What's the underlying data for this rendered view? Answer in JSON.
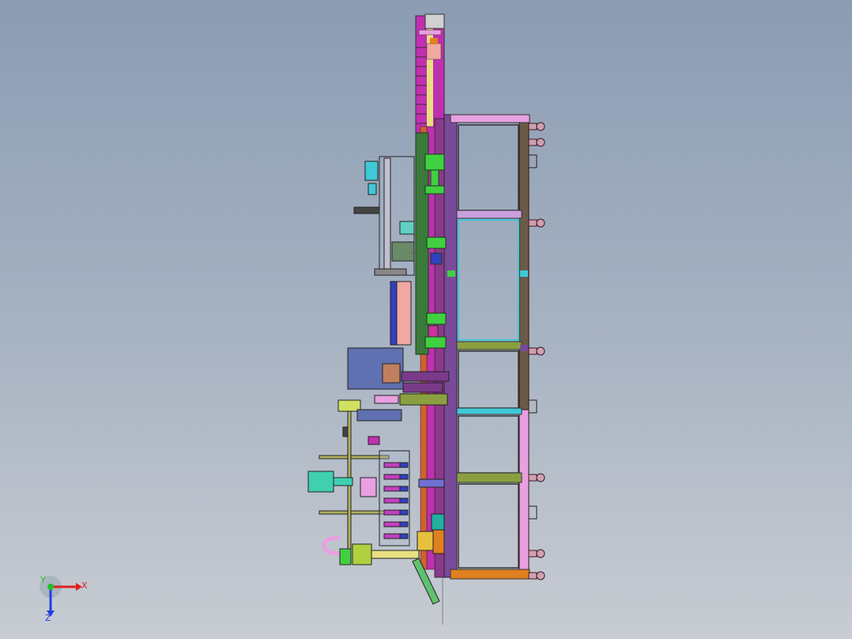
{
  "viewport": {
    "background_top": "#8b9cb3",
    "background_bottom": "#c8ccd3"
  },
  "model": {
    "palette": {
      "frame_brown": "#6b5a48",
      "frame_purple": "#7a4a9a",
      "frame_pink": "#e8a0e0",
      "frame_cyan": "#40c8d8",
      "frame_olive": "#8aa040",
      "rail_green": "#3a7a3a",
      "bright_green": "#40d040",
      "magenta": "#c030b0",
      "yellow": "#e8e080",
      "slate_blue": "#6070b0",
      "salmon": "#f0a8a0",
      "blue": "#3040c0",
      "orange": "#e08020",
      "teal": "#20b0a0"
    }
  },
  "triad": {
    "x_label": "X",
    "y_label": "Y",
    "z_label": "Z",
    "x_color": "#e02020",
    "y_color": "#20c020",
    "z_color": "#2040e0"
  }
}
